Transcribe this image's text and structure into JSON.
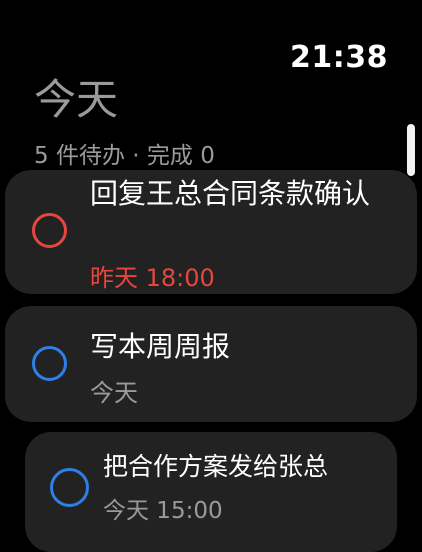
{
  "status": {
    "time": "21:38"
  },
  "header": {
    "title": "今天",
    "summary": "5 件待办 · 完成 0"
  },
  "tasks": [
    {
      "title": "回复王总合同条款确认",
      "meta": "昨天 18:00",
      "status": "overdue",
      "ring_color": "#e5473f"
    },
    {
      "title": "写本周周报",
      "meta": "今天",
      "status": "today",
      "ring_color": "#2e80e8"
    },
    {
      "title": "把合作方案发给张总",
      "meta": "今天 15:00",
      "status": "today",
      "ring_color": "#2e80e8"
    }
  ],
  "colors": {
    "background": "#000000",
    "card": "#222223",
    "overdue": "#e5473f",
    "accent": "#2e80e8",
    "secondary_text": "#9a9a9a"
  }
}
